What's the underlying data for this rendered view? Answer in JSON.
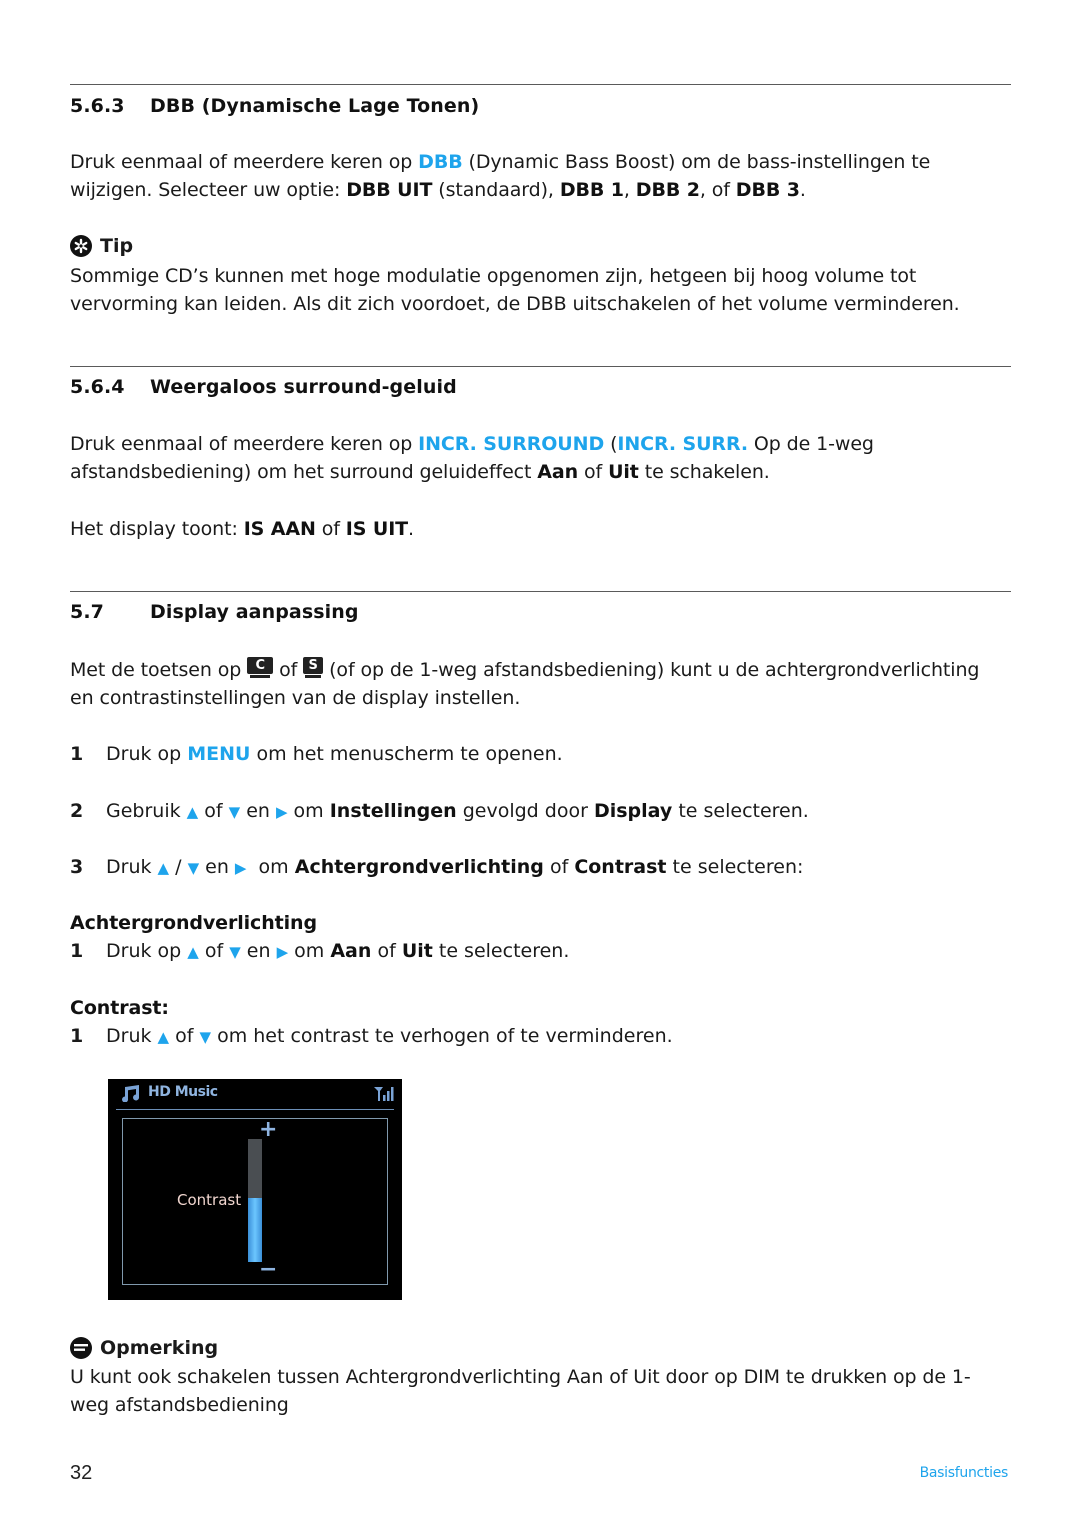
{
  "section_563": {
    "number": "5.6.3",
    "title": "DBB (Dynamische Lage Tonen)",
    "para": {
      "t1": "Druk eenmaal of meerdere keren op ",
      "key": "DBB",
      "t2": " (Dynamic Bass Boost) om de bass-instellingen te",
      "t3": "wijzigen. Selecteer uw optie: ",
      "opt1": "DBB UIT",
      "t4": " (standaard), ",
      "opt2": "DBB 1",
      "t5": ", ",
      "opt3": "DBB 2",
      "t6": ", of ",
      "opt4": "DBB 3",
      "t7": "."
    },
    "tip": {
      "label": "Tip",
      "line1": "Sommige CD’s kunnen met hoge modulatie opgenomen zijn, hetgeen bij hoog volume tot",
      "line2": "vervorming kan leiden. Als dit zich voordoet, de DBB uitschakelen of het volume verminderen."
    }
  },
  "section_564": {
    "number": "5.6.4",
    "title": "Weergaloos surround-geluid",
    "para": {
      "t1": "Druk eenmaal of meerdere keren op ",
      "key1": "INCR. SURROUND",
      "t2": " (",
      "key2": "INCR. SURR.",
      "t3": " Op de 1-weg",
      "t4": "afstandsbediening) om het surround geluideffect ",
      "on": "Aan",
      "t5": " of ",
      "off": "Uit",
      "t6": " te schakelen."
    },
    "display": {
      "t1": "Het display toont: ",
      "v1": "IS AAN",
      "t2": " of ",
      "v2": "IS UIT",
      "t3": "."
    }
  },
  "section_57": {
    "number": "5.7",
    "title": "Display aanpassing",
    "intro": {
      "t1": "Met de toetsen op ",
      "key_c": "C",
      "t2": " of ",
      "key_s": "S",
      "t3": " (of op de 1-weg afstandsbediening) kunt u de achtergrondverlichting",
      "t4": "en contrastinstellingen van de display instellen."
    },
    "steps": [
      {
        "n": "1",
        "t1": "Druk op ",
        "key": "MENU",
        "t2": " om het menuscherm te openen."
      },
      {
        "n": "2",
        "t1": "Gebruik ",
        "up": "▲",
        "t2": " of ",
        "down": "▼",
        "t3": " en ",
        "right": "▶",
        "t4": " om ",
        "b1": "Instellingen",
        "t5": " gevolgd door ",
        "b2": "Display",
        "t6": " te selecteren."
      },
      {
        "n": "3",
        "t1": "Druk ",
        "up": "▲",
        "t2": " / ",
        "down": "▼",
        "t3": " en ",
        "right": "▶",
        "t4": "  om ",
        "b1": "Achtergrondverlichting",
        "t5": " of ",
        "b2": "Contrast",
        "t6": " te selecteren:"
      }
    ],
    "backlight": {
      "heading": "Achtergrondverlichting",
      "step": {
        "n": "1",
        "t1": "Druk op ",
        "up": "▲",
        "t2": " of ",
        "down": "▼",
        "t3": " en ",
        "right": "▶",
        "t4": " om ",
        "b1": "Aan",
        "t5": " of ",
        "b2": "Uit",
        "t6": " te selecteren."
      }
    },
    "contrast": {
      "heading": "Contrast:",
      "step": {
        "n": "1",
        "t1": "Druk ",
        "up": "▲",
        "t2": " of ",
        "down": "▼",
        "t3": " om het contrast te verhogen of te verminderen."
      }
    },
    "device_screen": {
      "title": "HD Music",
      "label": "Contrast",
      "plus": "+",
      "minus": "−",
      "level_fraction": 0.52,
      "icons": [
        "music-note-icon",
        "signal-strength-icon"
      ]
    },
    "note": {
      "label": "Opmerking",
      "line1": "U kunt ook schakelen tussen Achtergrondverlichting Aan of Uit door op DIM te drukken op de 1-",
      "line2": "weg afstandsbediening"
    }
  },
  "footer": {
    "page_number": "32",
    "section_name": "Basisfuncties"
  },
  "colors": {
    "accent": "#1ea4ec",
    "text": "#1a1a1a",
    "rule": "#5a5a5a"
  }
}
